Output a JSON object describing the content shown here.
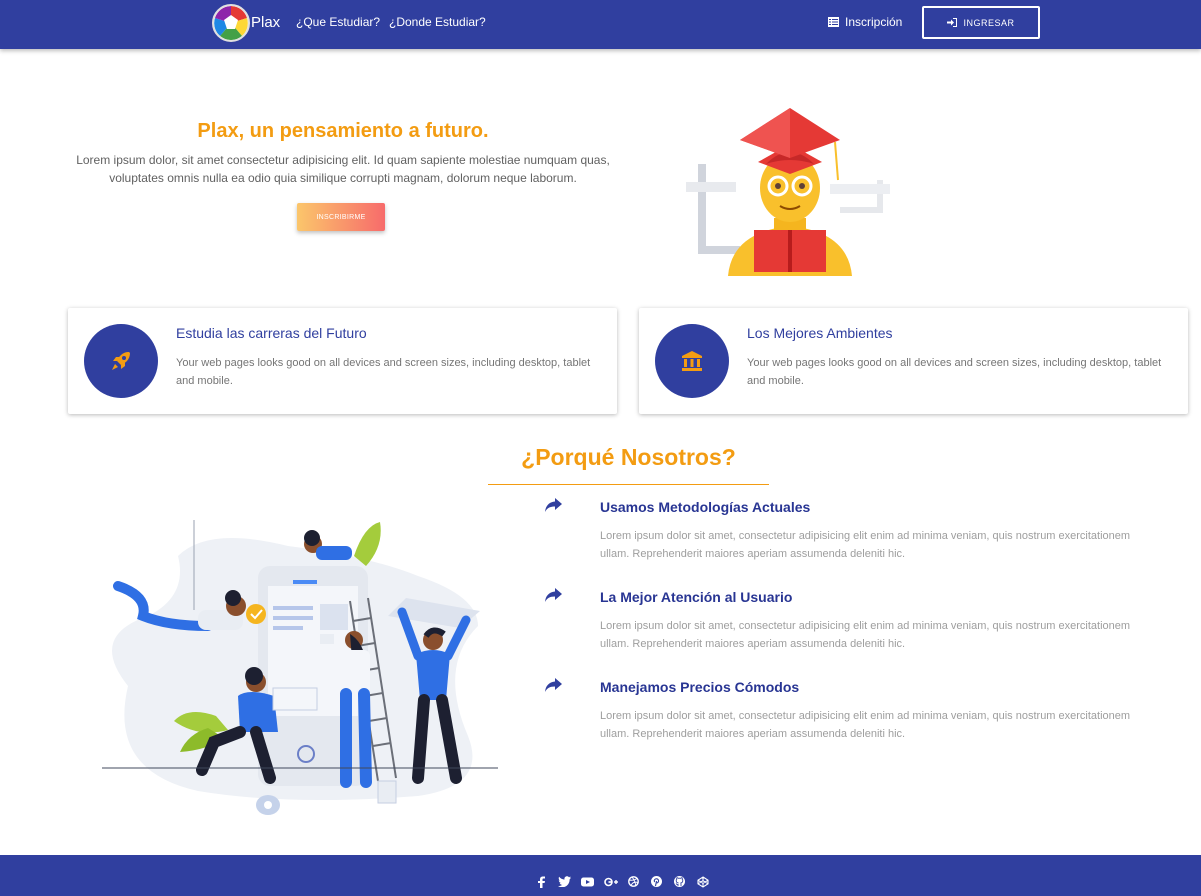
{
  "navbar": {
    "brand": "Plax",
    "links": [
      "¿Que Estudiar?",
      "¿Donde Estudiar?"
    ],
    "signup_label": "Inscripción",
    "login_label": "INGRESAR"
  },
  "hero": {
    "title": "Plax, un pensamiento a futuro.",
    "text": "Lorem ipsum dolor, sit amet consectetur adipisicing elit. Id quam sapiente molestiae numquam quas, voluptates omnis nulla ea odio quia similique corrupti magnam, dolorum neque laborum.",
    "button_label": "INSCRIBIRME"
  },
  "features": [
    {
      "icon": "rocket-icon",
      "title": "Estudia las carreras del Futuro",
      "text": "Your web pages looks good on all devices and screen sizes, including desktop, tablet and mobile."
    },
    {
      "icon": "bank-icon",
      "title": "Los Mejores Ambientes",
      "text": "Your web pages looks good on all devices and screen sizes, including desktop, tablet and mobile."
    }
  ],
  "why": {
    "title": "¿Porqué Nosotros?",
    "items": [
      {
        "title": "Usamos Metodologías Actuales",
        "text": "Lorem ipsum dolor sit amet, consectetur adipisicing elit enim ad minima veniam, quis nostrum exercitationem ullam. Reprehenderit maiores aperiam assumenda deleniti hic."
      },
      {
        "title": "La Mejor Atención al Usuario",
        "text": "Lorem ipsum dolor sit amet, consectetur adipisicing elit enim ad minima veniam, quis nostrum exercitationem ullam. Reprehenderit maiores aperiam assumenda deleniti hic."
      },
      {
        "title": "Manejamos Precios Cómodos",
        "text": "Lorem ipsum dolor sit amet, consectetur adipisicing elit enim ad minima veniam, quis nostrum exercitationem ullam. Reprehenderit maiores aperiam assumenda deleniti hic."
      }
    ]
  },
  "footer": {
    "social_icons": [
      "facebook-icon",
      "twitter-icon",
      "youtube-icon",
      "google-plus-icon",
      "dribbble-icon",
      "pinterest-icon",
      "github-icon",
      "codepen-icon"
    ]
  },
  "colors": {
    "primary": "#303f9f",
    "accent": "#f39c12"
  }
}
